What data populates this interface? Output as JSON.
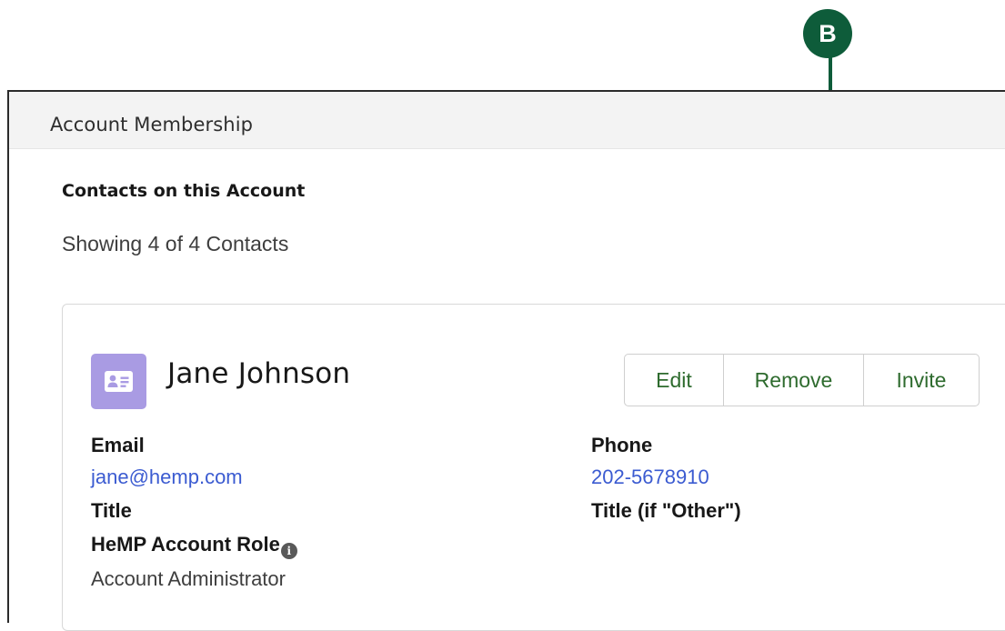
{
  "panel": {
    "title": "Account Membership"
  },
  "section": {
    "title": "Contacts on this Account",
    "showing_text": "Showing 4 of 4 Contacts"
  },
  "contact_card": {
    "avatar_icon": "contact-card-icon",
    "name": "Jane Johnson",
    "buttons": {
      "edit": "Edit",
      "remove": "Remove",
      "invite": "Invite"
    },
    "fields": {
      "email_label": "Email",
      "email_value": "jane@hemp.com",
      "phone_label": "Phone",
      "phone_value": "202-5678910",
      "title_label": "Title",
      "title_other_label": "Title (if \"Other\")",
      "role_label": "HeMP Account Role",
      "role_value": "Account Administrator"
    }
  },
  "callout": {
    "label": "B",
    "color": "#0e5c3a"
  },
  "colors": {
    "avatar_bg": "#a99be3",
    "button_text": "#2e6b2e",
    "link": "#3b5bd1"
  }
}
